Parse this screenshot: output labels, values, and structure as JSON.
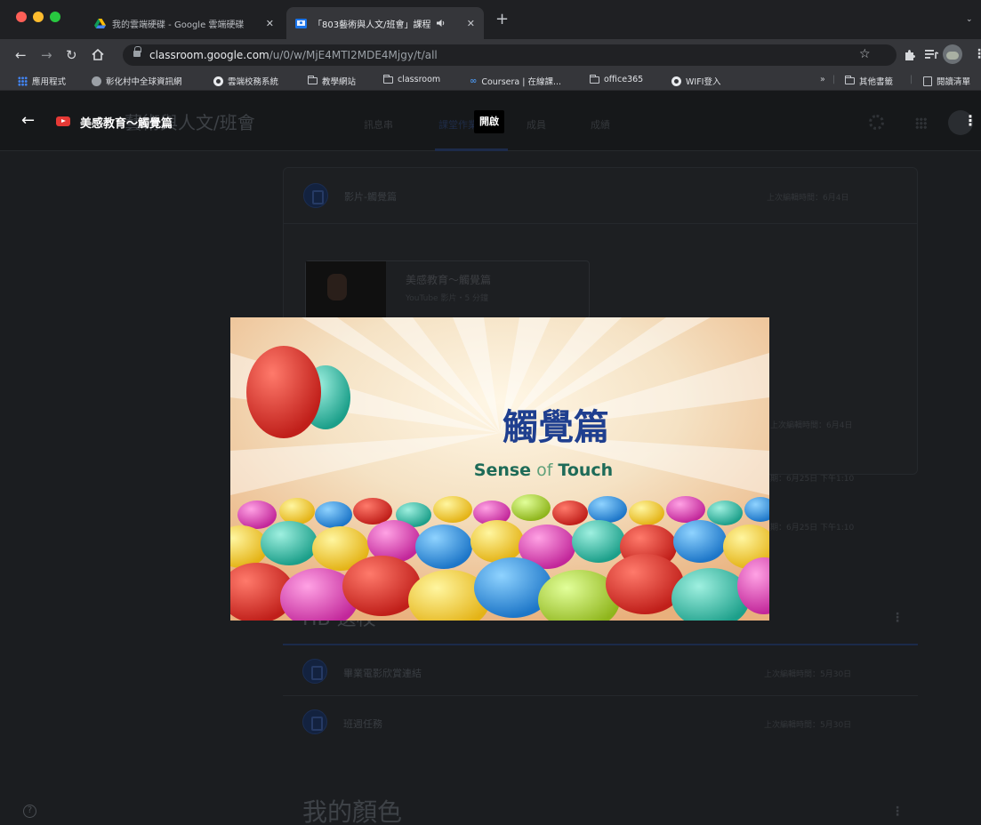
{
  "browser": {
    "tabs": [
      {
        "title": "我的雲端硬碟 - Google 雲端硬碟",
        "active": false
      },
      {
        "title": "「803藝術與人文/班會」課程",
        "active": true
      }
    ],
    "close_glyph": "✕",
    "new_tab_glyph": "+",
    "url_host": "classroom.google.com",
    "url_path": "/u/0/w/MjE4MTI2MDE4Mjgy/t/all",
    "bookmarks": [
      {
        "label": "應用程式",
        "icon": "apps-grid-icon"
      },
      {
        "label": "彰化村中全球資訊網",
        "icon": "site-icon"
      },
      {
        "label": "雲端校務系統",
        "icon": "globe-icon"
      },
      {
        "label": "教學網站",
        "icon": "folder-icon"
      },
      {
        "label": "classroom",
        "icon": "folder-icon"
      },
      {
        "label": "Coursera | 在線課...",
        "icon": "coursera-icon"
      },
      {
        "label": "office365",
        "icon": "folder-icon"
      },
      {
        "label": "WIFI登入",
        "icon": "globe-icon"
      }
    ],
    "bookmarks_overflow": "»",
    "other_bookmarks": "其他書籤",
    "reading_list": "閱讀清單"
  },
  "classroom": {
    "header_title": "藝術與人文/班會",
    "tabs": [
      "訊息串",
      "課堂作業",
      "成員",
      "成績"
    ],
    "stream": {
      "topic_title": "影片-觸覺篇",
      "topic_meta": "上次編輯時間：6月4日",
      "attachment_title": "美感教育～觸覺篇",
      "attachment_meta": "YouTube 影片・5 分鐘",
      "rows_meta": [
        "上次編輯時間：6月4日",
        "期：6月25日 下午1:10",
        "期：6月25日 下午1:10"
      ]
    },
    "section_partial": "HB 選校",
    "section_rows": [
      {
        "title": "畢業電影欣賞連結",
        "meta": "上次編輯時間：5月30日"
      },
      {
        "title": "班週任務",
        "meta": "上次編輯時間：5月30日"
      }
    ],
    "section_heading": "我的顏色"
  },
  "viewer": {
    "title": "美感教育～觸覺篇",
    "open_label": "開啟",
    "video": {
      "title_text": "觸覺篇",
      "subtitle_sense": "Sense",
      "subtitle_of": "of",
      "subtitle_touch": "Touch"
    }
  },
  "colors": {
    "youtube_red": "#e53935",
    "video_title": "#1f3f8f",
    "video_subtitle": "#1e6b58"
  }
}
